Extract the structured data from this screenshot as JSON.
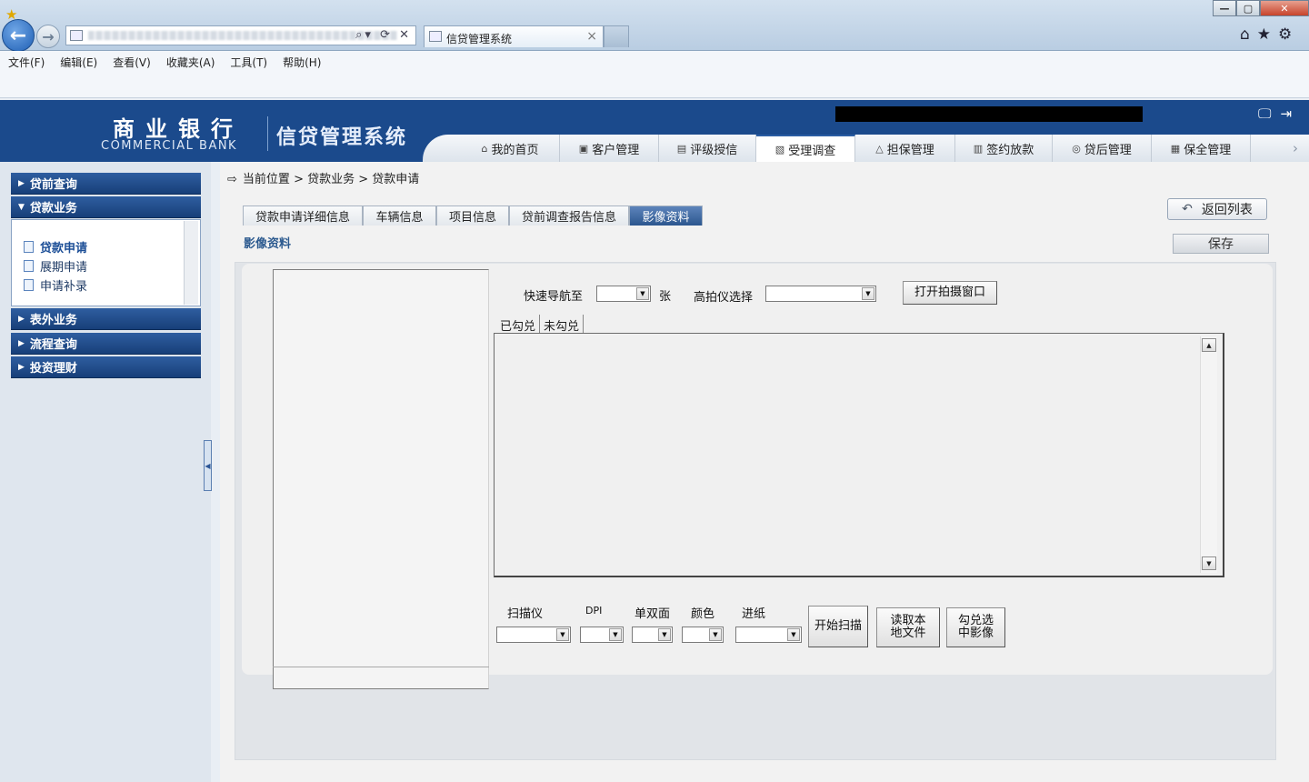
{
  "browser": {
    "tab_title": "信贷管理系统",
    "tab_close": "×",
    "window_buttons": [
      "—",
      "▢",
      "✕"
    ],
    "menu": [
      "文件(F)",
      "编辑(E)",
      "查看(V)",
      "收藏夹(A)",
      "工具(T)",
      "帮助(H)"
    ],
    "address_icons": "⌕▾ ⟳ ✕",
    "tool_icons": "⌂★⚙"
  },
  "header": {
    "logo_cn": "商业银行",
    "logo_en": "COMMERCIAL BANK",
    "system_title": "信贷管理系统",
    "nav_tabs": [
      {
        "label": "我的首页",
        "icon": "⌂"
      },
      {
        "label": "客户管理",
        "icon": "▣"
      },
      {
        "label": "评级授信",
        "icon": "▤"
      },
      {
        "label": "受理调查",
        "icon": "▧"
      },
      {
        "label": "担保管理",
        "icon": "△"
      },
      {
        "label": "签约放款",
        "icon": "▥"
      },
      {
        "label": "贷后管理",
        "icon": "◎"
      },
      {
        "label": "保全管理",
        "icon": "▦"
      }
    ],
    "active_nav_index": 3
  },
  "sidebar": {
    "groups": [
      "贷前查询",
      "贷款业务",
      "表外业务",
      "流程查询",
      "投资理财"
    ],
    "loan_items": [
      "贷款申请",
      "展期申请",
      "申请补录"
    ],
    "active_item": "贷款申请"
  },
  "breadcrumb": {
    "label": "当前位置",
    "path": "贷款业务 > 贷款申请",
    "sep": ">"
  },
  "subtabs": [
    "贷款申请详细信息",
    "车辆信息",
    "项目信息",
    "贷前调查报告信息",
    "影像资料"
  ],
  "active_subtab": "影像资料",
  "actions": {
    "back_list": "返回列表",
    "save": "保存"
  },
  "section_title": "影像资料",
  "scanner": {
    "quick_nav_label": "快速导航至",
    "quick_nav_unit": "张",
    "camera_select_label": "高拍仪选择",
    "open_camera_button": "打开拍摄窗口",
    "checked_tab": "已勾兑",
    "unchecked_tab": "未勾兑",
    "field_labels": [
      "扫描仪",
      "DPI",
      "单双面",
      "颜色",
      "进纸"
    ],
    "start_scan_button": "开始扫描",
    "read_local_button": "读取本地文件",
    "check_selected_button": "勾兑选中影像"
  }
}
